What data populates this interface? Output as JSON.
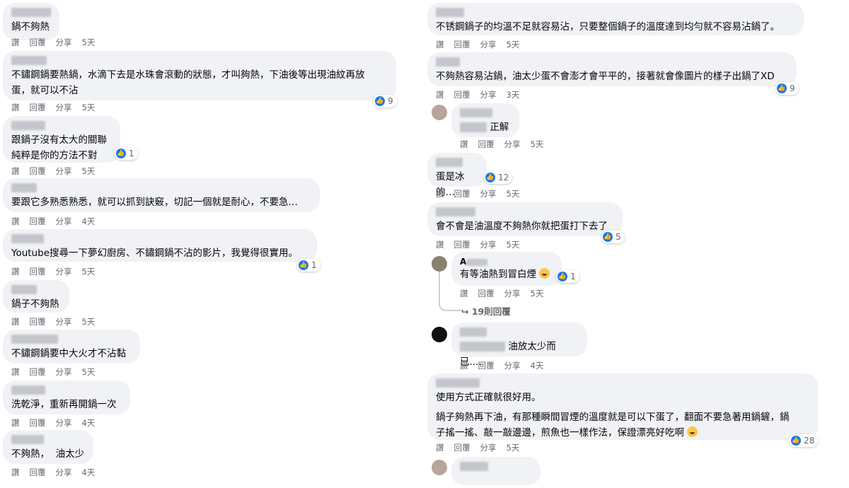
{
  "actions": {
    "like": "讚",
    "reply": "回覆",
    "share": "分享"
  },
  "left": [
    {
      "text": "鍋不夠熱",
      "time": "5天"
    },
    {
      "text": "不鏽鋼鍋要熱鍋，水滴下去是水珠會滾動的狀態，才叫夠熱，下油後等出現油紋再放\n蛋，就可以不沾",
      "time": "5天",
      "reactions": "9"
    },
    {
      "text": "跟鍋子沒有太大的關聯\n純粹是你的方法不對",
      "time": "5天",
      "reactions": "1"
    },
    {
      "text": "要跟它多熟悉熟悉，就可以抓到訣竅，切記一個就是耐心，不要急…",
      "time": "4天"
    },
    {
      "text": "Youtube搜尋一下夢幻廚房、不鏽鋼鍋不沾的影片，我覺得很實用。",
      "time": "5天",
      "reactions": "1"
    },
    {
      "text": "鍋子不夠熱",
      "time": "5天"
    },
    {
      "text": "不鏽鋼鍋要中大火才不沾黏",
      "time": "5天"
    },
    {
      "text": "洗乾淨，重新再開鍋一次",
      "time": "4天"
    },
    {
      "text": "不夠熱，  油太少",
      "time": "4天"
    }
  ],
  "right": [
    {
      "text": "不锈鋼鍋子的均溫不足就容易沾，只要整個鍋子的溫度達到均勻就不容易沾鍋了。",
      "time": "5天"
    },
    {
      "text": "不夠熱容易沾鍋，油太少蛋不會澎才會平平的，接著就會像圖片的樣子出鍋了XD",
      "time": "3天",
      "reactions": "9"
    },
    {
      "text": "正解",
      "time": "5天"
    },
    {
      "text": "蛋是冰的…",
      "time": "5天",
      "reactions": "12"
    },
    {
      "text": "會不會是油溫度不夠熱你就把蛋打下去了",
      "time": "5天",
      "reactions": "5"
    },
    {
      "text": "有等油熱到冒白煙",
      "time": "5天",
      "reactions": "1",
      "name": "A"
    },
    {
      "text": "油放太少而已.....",
      "time": "4天"
    },
    {
      "text": "使用方式正確就很好用。",
      "text2": "鍋子夠熱再下油，有那種瞬間冒煙的溫度就是可以下蛋了，翻面不要急著用鍋鏟，鍋\n子搖一搖、敲一敲邊邊，煎魚也一樣作法，保證漂亮好吃啊",
      "time": "5天",
      "reactions": "28"
    }
  ],
  "more_replies": "19則回覆",
  "colors": {
    "like_blue": "#1877f2",
    "bubble": "#f0f2f5",
    "meta": "#65676b"
  },
  "icons": {
    "like": "thumbs-up-icon",
    "laugh": "laughing-emoji-icon",
    "reply_arrow": "reply-arrow-icon"
  }
}
